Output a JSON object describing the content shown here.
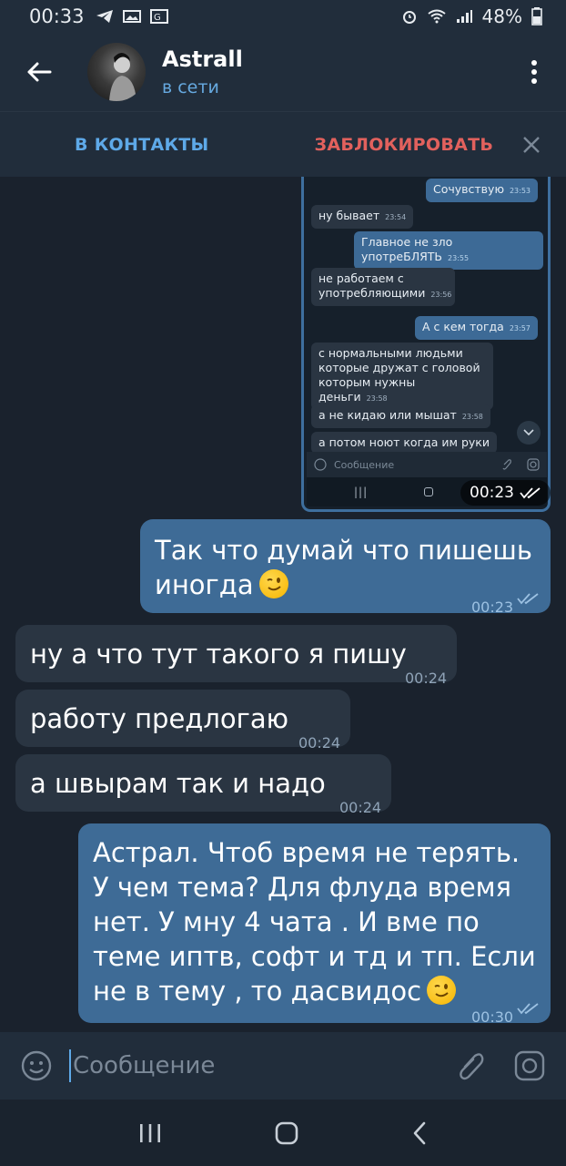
{
  "status_bar": {
    "time": "00:33",
    "battery": "48%"
  },
  "header": {
    "title": "Astrall",
    "subtitle": "в сети"
  },
  "actions": {
    "add_contact": "В КОНТАКТЫ",
    "block": "ЗАБЛОКИРОВАТЬ"
  },
  "screenshot": {
    "messages": [
      {
        "text": "Сочувствую",
        "time": "23:53",
        "dir": "out"
      },
      {
        "text": "ну бывает",
        "time": "23:54",
        "dir": "in"
      },
      {
        "text": "Главное не зло употреБЛЯТЬ",
        "time": "23:55",
        "dir": "out"
      },
      {
        "text": "не работаем с употребляющими",
        "time": "23:56",
        "dir": "in"
      },
      {
        "text": "А с кем тогда",
        "time": "23:57",
        "dir": "out"
      },
      {
        "text": "с нормальными людьми которые дружат с головой которым нужны деньги",
        "time": "23:58",
        "dir": "in"
      },
      {
        "text": "а не кидаю или мышат",
        "time": "23:58",
        "dir": "in"
      },
      {
        "text": "а потом ноют когда им руки",
        "time": "",
        "dir": "in"
      }
    ],
    "input_placeholder": "Сообщение",
    "time": "00:23"
  },
  "messages": [
    {
      "text": "Так что думай что пишешь иногда",
      "time": "00:23",
      "dir": "out"
    },
    {
      "text": "ну а что тут такого я пишу",
      "time": "00:24",
      "dir": "in"
    },
    {
      "text": "работу предлогаю",
      "time": "00:24",
      "dir": "in"
    },
    {
      "text": "а швырам так и надо",
      "time": "00:24",
      "dir": "in"
    },
    {
      "text": "Астрал. Чтоб время не терять. У чем тема? Для флуда время нет. У мну 4 чата . И вме по теме иптв, софт и тд и тп. Если не в тему , то дасвидос",
      "time": "00:30",
      "dir": "out"
    }
  ],
  "input": {
    "placeholder": "Сообщение"
  },
  "colors": {
    "accent": "#5ea9e8",
    "danger": "#e2615d",
    "bubble_out": "#3e6b96",
    "bubble_in": "#2a3542"
  }
}
